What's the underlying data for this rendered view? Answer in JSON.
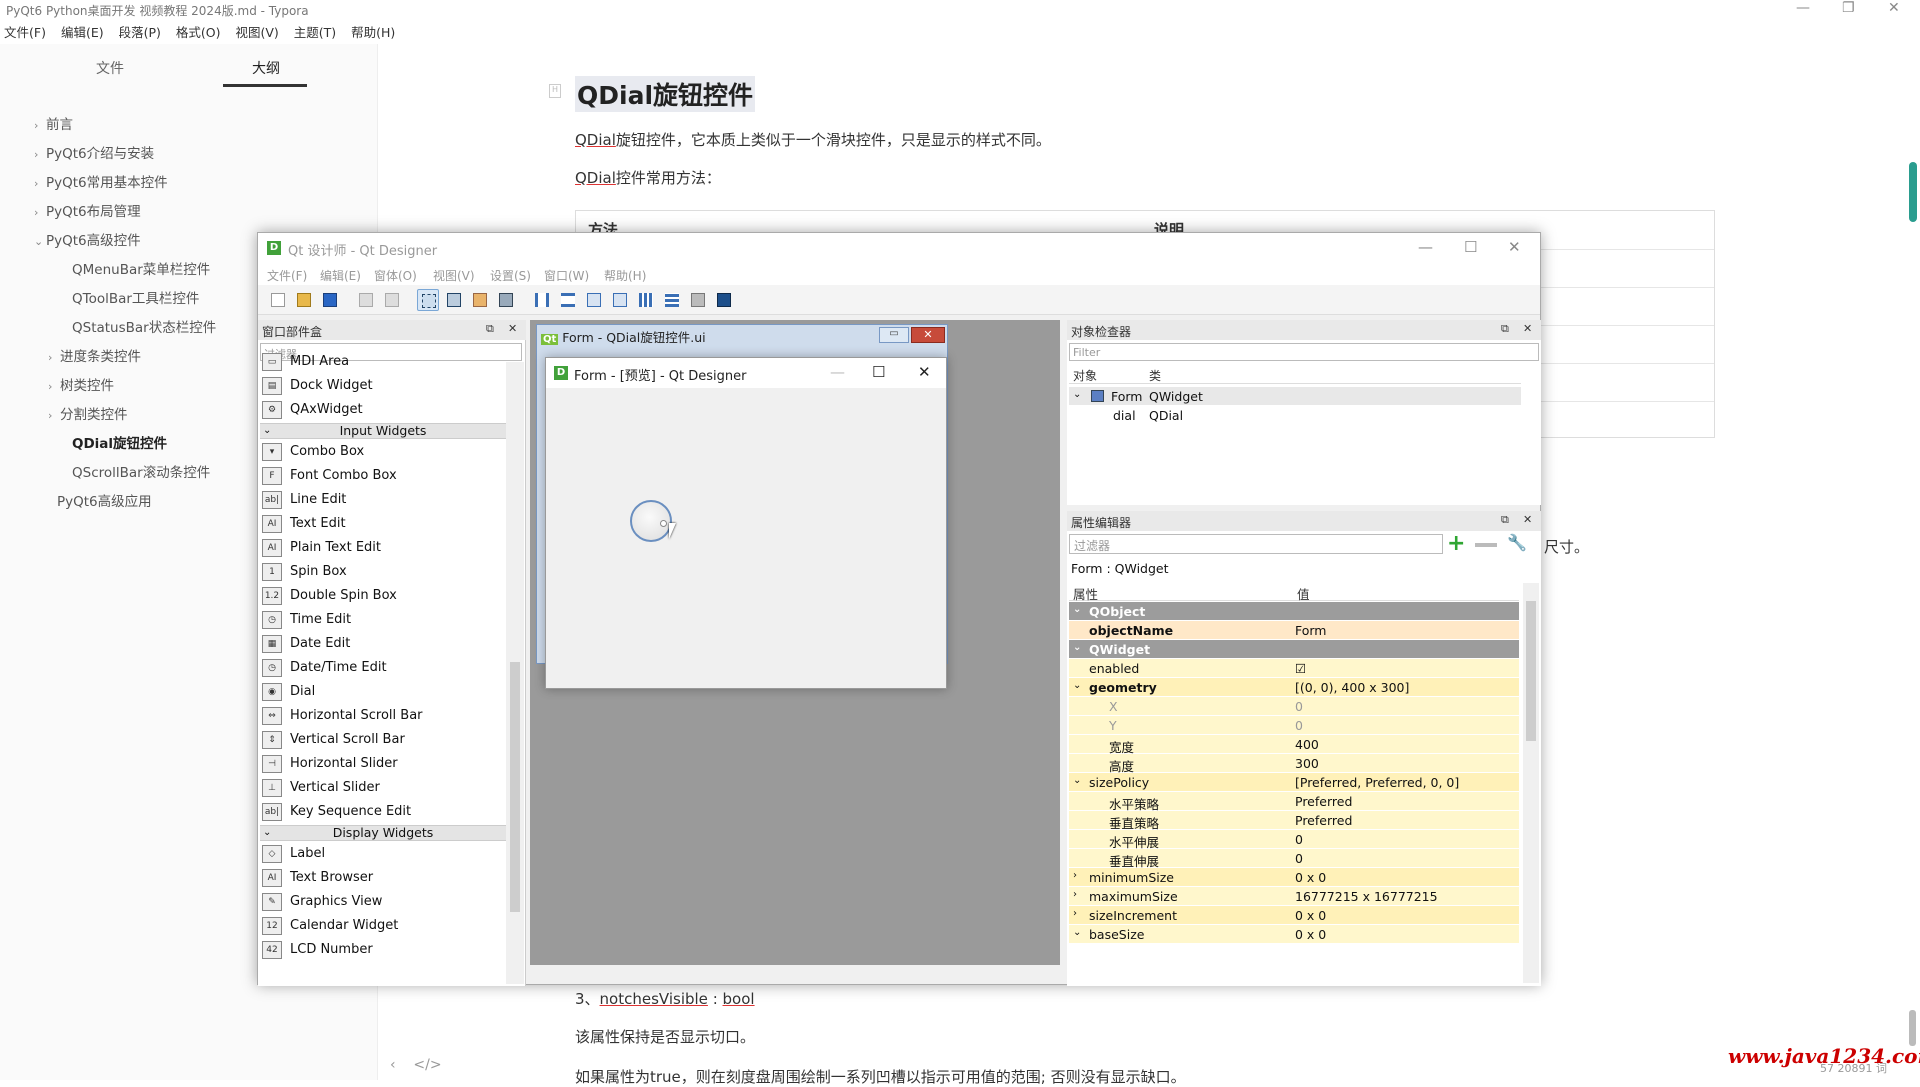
{
  "app": {
    "title": "PyQt6 Python桌面开发 视频教程 2024版.md - Typora",
    "menu": [
      "文件(F)",
      "编辑(E)",
      "段落(P)",
      "格式(O)",
      "视图(V)",
      "主题(T)",
      "帮助(H)"
    ],
    "window_controls": {
      "minimize": "—",
      "restore": "❐",
      "close": "✕"
    }
  },
  "sidebar": {
    "tabs": {
      "files": "文件",
      "outline": "大纲"
    },
    "items": [
      {
        "label": "前言",
        "chev": "›"
      },
      {
        "label": "PyQt6介绍与安装",
        "chev": "›"
      },
      {
        "label": "PyQt6常用基本控件",
        "chev": "›"
      },
      {
        "label": "PyQt6布局管理",
        "chev": "›"
      },
      {
        "label": "PyQt6高级控件",
        "chev": "⌄"
      },
      {
        "label": "QMenuBar菜单栏控件",
        "chev": ""
      },
      {
        "label": "QToolBar工具栏控件",
        "chev": ""
      },
      {
        "label": "QStatusBar状态栏控件",
        "chev": ""
      },
      {
        "label": "进度条类控件",
        "chev": "›"
      },
      {
        "label": "树类控件",
        "chev": "›"
      },
      {
        "label": "分割类控件",
        "chev": "›"
      },
      {
        "label": "QDial旋钮控件",
        "chev": ""
      },
      {
        "label": "QScrollBar滚动条控件",
        "chev": ""
      },
      {
        "label": "PyQt6高级应用",
        "chev": ""
      }
    ],
    "footer": {
      "back": "‹",
      "source": "</>"
    }
  },
  "document": {
    "heading": "QDial旋钮控件",
    "para1_a": "QDial",
    "para1_b": "旋钮控件，它本质上类似于一个滑块控件，只是显示的样式不同。",
    "para2_a": "QDial",
    "para2_b": "控件常用方法：",
    "table": {
      "col1": "方法",
      "col2": "说明"
    },
    "behind_text": "尺寸。",
    "para3_a": "3、",
    "para3_b": "notchesVisible",
    "para3_c": " : ",
    "para3_d": "bool",
    "para4": "该属性保持是否显示切口。",
    "para5": "如果属性为true，则在刻度盘周围绘制一系列凹槽以指示可用值的范围; 否则没有显示缺口。",
    "watermark": "www.java1234.com",
    "wordcount": "57 20891 词"
  },
  "designer": {
    "title": "Qt 设计师 - Qt Designer",
    "menu": [
      "文件(F)",
      "编辑(E)",
      "窗体(O)",
      "视图(V)",
      "设置(S)",
      "窗口(W)",
      "帮助(H)"
    ],
    "widget_box": {
      "title": "窗口部件盒",
      "filter_placeholder": "过滤器",
      "items_top": [
        {
          "label": "MDI Area",
          "icon": "▭"
        },
        {
          "label": "Dock Widget",
          "icon": "▤"
        },
        {
          "label": "QAxWidget",
          "icon": "⚙"
        }
      ],
      "category_input": "Input Widgets",
      "items_input": [
        {
          "label": "Combo Box",
          "icon": "▾"
        },
        {
          "label": "Font Combo Box",
          "icon": "F"
        },
        {
          "label": "Line Edit",
          "icon": "ab|"
        },
        {
          "label": "Text Edit",
          "icon": "AI"
        },
        {
          "label": "Plain Text Edit",
          "icon": "AI"
        },
        {
          "label": "Spin Box",
          "icon": "1"
        },
        {
          "label": "Double Spin Box",
          "icon": "1.2"
        },
        {
          "label": "Time Edit",
          "icon": "◷"
        },
        {
          "label": "Date Edit",
          "icon": "▦"
        },
        {
          "label": "Date/Time Edit",
          "icon": "◷"
        },
        {
          "label": "Dial",
          "icon": "◉"
        },
        {
          "label": "Horizontal Scroll Bar",
          "icon": "⇔"
        },
        {
          "label": "Vertical Scroll Bar",
          "icon": "⇕"
        },
        {
          "label": "Horizontal Slider",
          "icon": "⊣"
        },
        {
          "label": "Vertical Slider",
          "icon": "⊥"
        },
        {
          "label": "Key Sequence Edit",
          "icon": "ab|"
        }
      ],
      "category_display": "Display Widgets",
      "items_display": [
        {
          "label": "Label",
          "icon": "◇"
        },
        {
          "label": "Text Browser",
          "icon": "AI"
        },
        {
          "label": "Graphics View",
          "icon": "✎"
        },
        {
          "label": "Calendar Widget",
          "icon": "12"
        },
        {
          "label": "LCD Number",
          "icon": "42"
        }
      ]
    },
    "form_window_title": "Form - QDial旋钮控件.ui",
    "preview": {
      "title": "Form - [预览] - Qt Designer",
      "controls": {
        "minimize": "—",
        "maximize": "☐",
        "close": "✕"
      }
    },
    "object_inspector": {
      "title": "对象检查器",
      "filter_placeholder": "Filter",
      "col_object": "对象",
      "col_class": "类",
      "rows": [
        {
          "object": "Form",
          "class": "QWidget",
          "chev": "⌄"
        },
        {
          "object": "dial",
          "class": "QDial",
          "chev": ""
        }
      ]
    },
    "property_editor": {
      "title": "属性编辑器",
      "filter_placeholder": "过滤器",
      "add": "+",
      "context": "Form : QWidget",
      "col_prop": "属性",
      "col_value": "值",
      "rows": [
        {
          "name": "QObject",
          "value": "",
          "kind": "group",
          "chev": "⌄"
        },
        {
          "name": "objectName",
          "value": "Form",
          "kind": "or",
          "chev": "",
          "bold": true
        },
        {
          "name": "QWidget",
          "value": "",
          "kind": "group",
          "chev": "⌄"
        },
        {
          "name": "enabled",
          "value": "☑",
          "kind": "yl",
          "chev": ""
        },
        {
          "name": "geometry",
          "value": "[(0, 0), 400 x 300]",
          "kind": "yl2",
          "chev": "⌄",
          "bold": true
        },
        {
          "name": "X",
          "value": "0",
          "kind": "yl",
          "chev": "",
          "dim": true,
          "sub": true
        },
        {
          "name": "Y",
          "value": "0",
          "kind": "yl",
          "chev": "",
          "dim": true,
          "sub": true
        },
        {
          "name": "宽度",
          "value": "400",
          "kind": "yl",
          "chev": "",
          "sub": true
        },
        {
          "name": "高度",
          "value": "300",
          "kind": "yl",
          "chev": "",
          "sub": true
        },
        {
          "name": "sizePolicy",
          "value": "[Preferred, Preferred, 0, 0]",
          "kind": "yl2",
          "chev": "⌄"
        },
        {
          "name": "水平策略",
          "value": "Preferred",
          "kind": "yl",
          "chev": "",
          "sub": true
        },
        {
          "name": "垂直策略",
          "value": "Preferred",
          "kind": "yl",
          "chev": "",
          "sub": true
        },
        {
          "name": "水平伸展",
          "value": "0",
          "kind": "yl",
          "chev": "",
          "sub": true
        },
        {
          "name": "垂直伸展",
          "value": "0",
          "kind": "yl",
          "chev": "",
          "sub": true
        },
        {
          "name": "minimumSize",
          "value": "0 x 0",
          "kind": "yl2",
          "chev": "›"
        },
        {
          "name": "maximumSize",
          "value": "16777215 x 16777215",
          "kind": "yl",
          "chev": "›"
        },
        {
          "name": "sizeIncrement",
          "value": "0 x 0",
          "kind": "yl2",
          "chev": "›"
        },
        {
          "name": "baseSize",
          "value": "0 x 0",
          "kind": "yl",
          "chev": "⌄"
        }
      ]
    }
  }
}
